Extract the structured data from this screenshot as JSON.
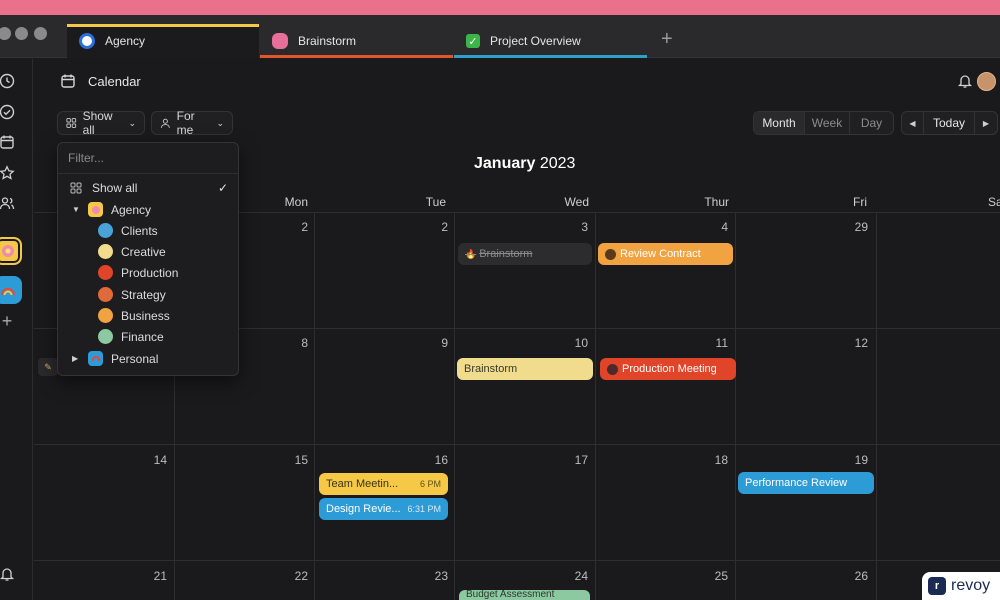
{
  "tabs": [
    {
      "label": "Agency",
      "line": "#f5c945",
      "icon_bg": "#ffffff",
      "icon": "agency-icon"
    },
    {
      "label": "Brainstorm",
      "line": "#e0572d",
      "icon_bg": "#e96f9b",
      "icon": "brain-icon"
    },
    {
      "label": "Project Overview",
      "line": "#2fa0c8",
      "icon_bg": "#3bb54a",
      "icon": "check-icon"
    }
  ],
  "header": {
    "title": "Calendar"
  },
  "filters": {
    "show_all": "Show all",
    "for_me": "For me"
  },
  "views": {
    "month": "Month",
    "week": "Week",
    "day": "Day",
    "today": "Today"
  },
  "calendar": {
    "month": "January",
    "year": "2023",
    "weekdays": [
      "Mon",
      "Tue",
      "Wed",
      "Thur",
      "Fri",
      "Sa"
    ],
    "rows": [
      [
        "2",
        "2",
        "3",
        "4",
        "29"
      ],
      [
        "8",
        "9",
        "10",
        "11",
        "12"
      ],
      [
        "14",
        "15",
        "16",
        "17",
        "18",
        "19"
      ],
      [
        "21",
        "22",
        "23",
        "24",
        "25",
        "26"
      ]
    ]
  },
  "events": {
    "brainstorm_1": "Brainstorm",
    "review_contract": "Review Contract",
    "brainstorm_2": "Brainstorm",
    "production_meeting": "Production Meeting",
    "team_meeting": "Team Meetin...",
    "team_meeting_time": "6 PM",
    "design_review": "Design Revie...",
    "design_review_time": "6:31 PM",
    "performance_review": "Performance Review",
    "budget_assessment": "Budget Assessment"
  },
  "dropdown": {
    "placeholder": "Filter...",
    "show_all": "Show all",
    "agency": "Agency",
    "items": [
      "Clients",
      "Creative",
      "Production",
      "Strategy",
      "Business",
      "Finance"
    ],
    "personal": "Personal"
  },
  "watermark": "revoy",
  "colors": {
    "yellow": "#f5c945",
    "orange": "#f0a340",
    "red": "#e0452a",
    "blue": "#2d9bd6",
    "sand": "#f0dc8c",
    "green": "#8cc8a0"
  }
}
